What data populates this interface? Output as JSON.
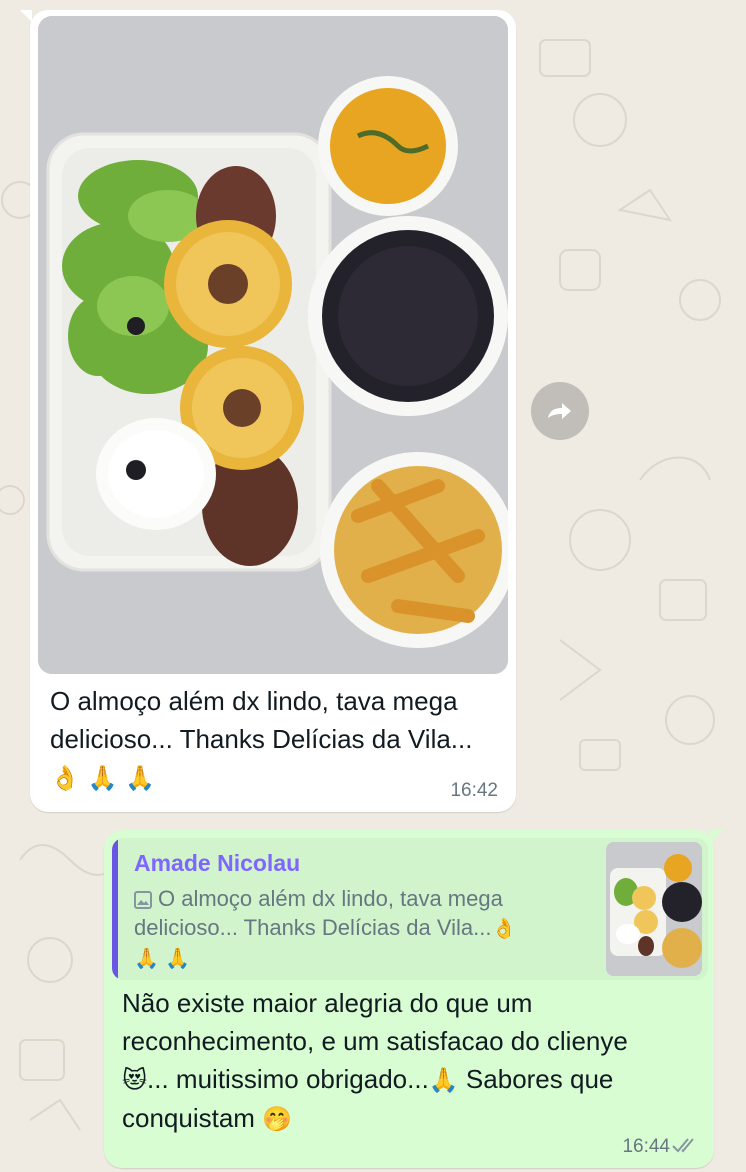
{
  "theme": {
    "chat_background": "#efeae2",
    "incoming_bubble": "#ffffff",
    "outgoing_bubble": "#d9fdd3",
    "quote_accent": "#7f66ff",
    "meta_text": "#667781"
  },
  "messages": [
    {
      "direction": "incoming",
      "media": {
        "type": "photo",
        "icon": "food-photo"
      },
      "caption": "O almoço além dx lindo, tava mega delicioso... Thanks Delícias da Vila...",
      "caption_emoji": "👌 🙏 🙏",
      "time": "16:42"
    },
    {
      "direction": "outgoing",
      "reply_to": {
        "author": "Amade Nicolau",
        "icon": "image-icon",
        "text": "O almoço além dx lindo, tava mega delicioso... Thanks Delícias da Vila...",
        "text_emoji": "👌",
        "text_emoji_line2": "🙏 🙏"
      },
      "text_line1": "Não existe maior alegria do que um reconhecimento, e um satisfacao do clienye",
      "emoji_heart_eyes_cat": "😻",
      "text_line2": "... muitissimo obrigado...",
      "emoji_pray": "🙏",
      "text_line3": " Sabores que conquistam ",
      "emoji_hand_over_mouth": "🤭",
      "time": "16:44",
      "status": "double-check-icon"
    }
  ],
  "actions": {
    "forward_icon": "forward-icon"
  }
}
